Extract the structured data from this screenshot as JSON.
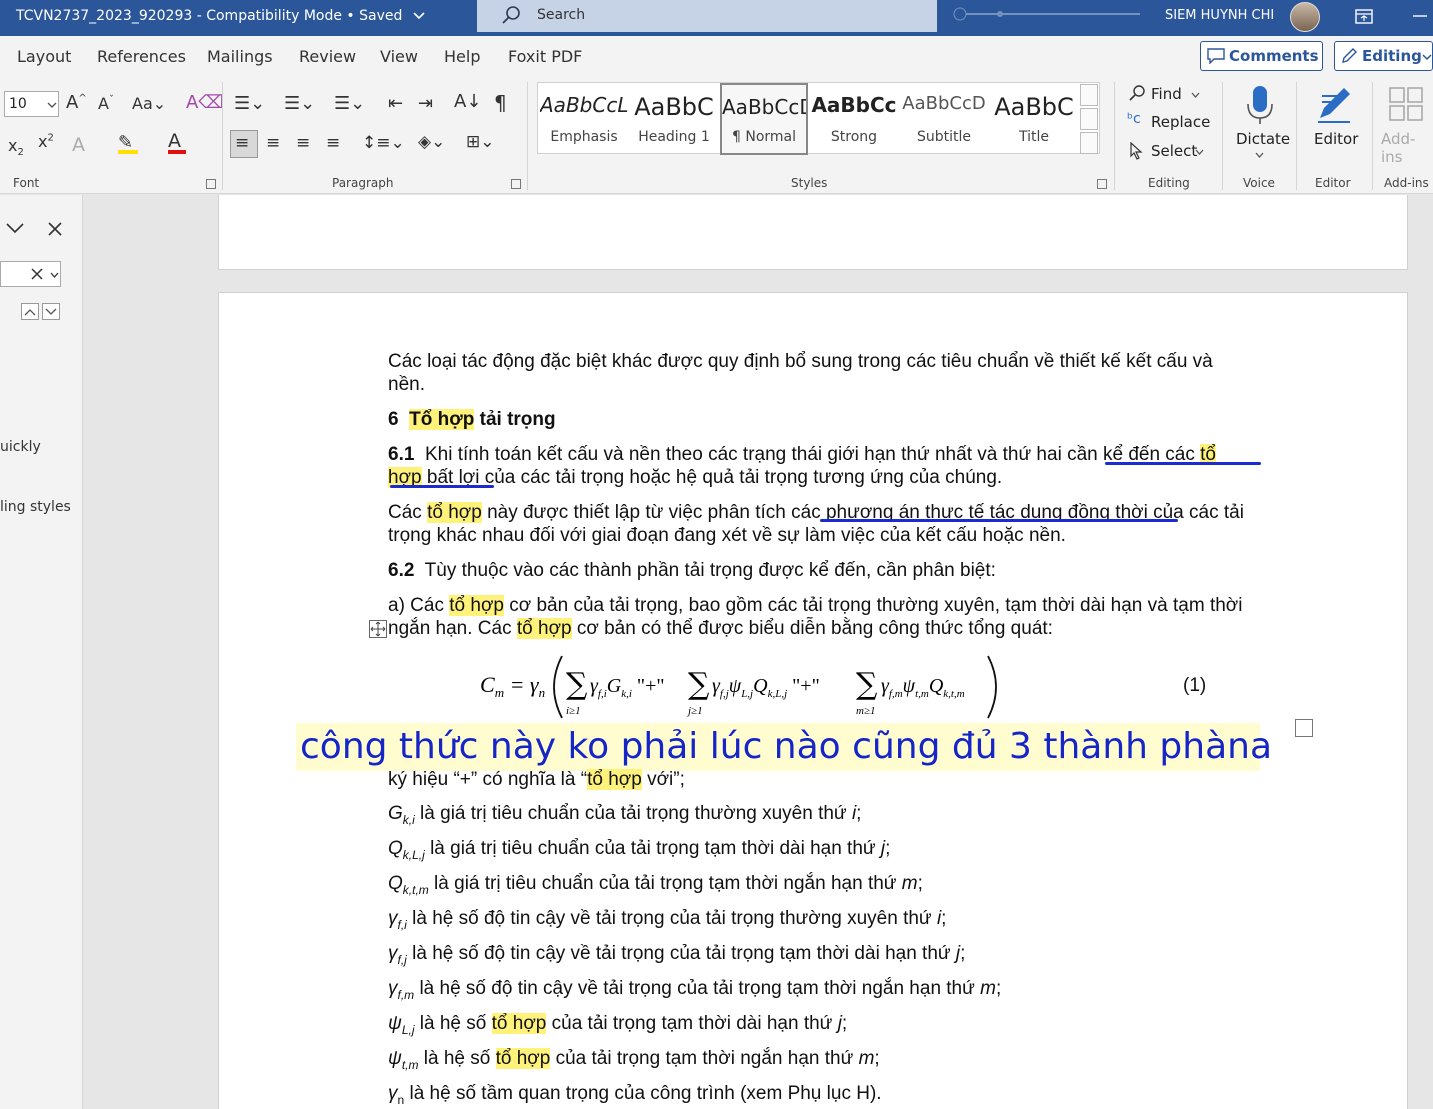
{
  "titlebar": {
    "doc_title": "TCVN2737_2023_920293 - Compatibility Mode • Saved",
    "search_label": "Search",
    "user_name": "SIEM HUYNH CHI"
  },
  "tabs": [
    "Layout",
    "References",
    "Mailings",
    "Review",
    "View",
    "Help",
    "Foxit PDF"
  ],
  "actions": {
    "comments": "Comments",
    "editing": "Editing"
  },
  "ribbon": {
    "font": {
      "size": "10",
      "label": "Font"
    },
    "paragraph_label": "Paragraph",
    "styles": {
      "label": "Styles",
      "items": [
        {
          "preview": "AaBbCcL",
          "name": "Emphasis"
        },
        {
          "preview": "AaBbC",
          "name": "Heading 1"
        },
        {
          "preview": "AaBbCcD",
          "name": "¶ Normal"
        },
        {
          "preview": "AaBbCc",
          "name": "Strong"
        },
        {
          "preview": "AaBbCcD",
          "name": "Subtitle"
        },
        {
          "preview": "AaBbC",
          "name": "Title"
        }
      ]
    },
    "editing": {
      "find": "Find",
      "replace": "Replace",
      "select": "Select",
      "label": "Editing"
    },
    "voice": {
      "dictate": "Dictate",
      "label": "Voice"
    },
    "editor": {
      "button": "Editor",
      "label": "Editor"
    },
    "addins": {
      "button": "Add-ins",
      "label": "Add-ins"
    }
  },
  "navpane": {
    "text1": "uickly",
    "text2": "ling styles"
  },
  "document": {
    "p1a": "Các loại tác động đặc biệt khác được quy định bổ sung trong các tiêu chuẩn về thiết kế kết cấu và",
    "p1b": "nền.",
    "h_num": "6",
    "h_hl": "Tổ hợp",
    "h_rest": " tải trọng",
    "p61_num": "6.1",
    "p61a_1": "Khi tính toán kết cấu và nền theo các trạng thái giới hạn thứ nhất và thứ hai cần kể đến các ",
    "p61a_hl": "tổ",
    "p61b_hl": "hợp",
    "p61b_rest": " bất lợi của các tải trọng hoặc hệ quả tải trọng tương ứng của chúng.",
    "p2a_1": "Các ",
    "p2a_hl": "tổ hợp",
    "p2a_rest": " này được thiết lập từ việc phân tích các phương án thực tế tác dụng đồng thời của các tải",
    "p2b": "trọng khác nhau đối với giai đoạn đang xét về sự làm việc của kết cấu hoặc nền.",
    "p62_num": "6.2",
    "p62_rest": "Tùy thuộc vào các thành phần tải trọng được kể đến, cần phân biệt:",
    "pa_1": "a) Các ",
    "pa_hl": "tổ hợp",
    "pa_rest": " cơ bản của tải trọng, bao gồm các tải trọng thường xuyên, tạm thời dài hạn và tạm thời",
    "pb_1": "ngắn hạn. Các ",
    "pb_hl": "tổ hợp",
    "pb_rest": " cơ bản có thể được biểu diễn bằng công thức tổng quát:",
    "eq_number": "(1)",
    "annotation": "công thức này ko phải lúc nào cũng đủ 3 thành phàna",
    "sym_1": "ký hiệu “+” có nghĩa là “",
    "sym_hl": "tổ hợp",
    "sym_2": " với”;",
    "d1_s": "G",
    "d1_sub": "k,i",
    "d1_t": " là giá trị tiêu chuẩn của tải trọng thường xuyên thứ ",
    "d1_i": "i",
    "d1_e": ";",
    "d2_s": "Q",
    "d2_sub": "k,L,j",
    "d2_t": " là giá trị tiêu chuẩn của tải trọng tạm thời dài hạn thứ ",
    "d2_i": "j",
    "d2_e": ";",
    "d3_s": "Q",
    "d3_sub": "k,t,m",
    "d3_t": " là giá trị tiêu chuẩn của tải trọng tạm thời ngắn hạn thứ ",
    "d3_i": "m",
    "d3_e": ";",
    "d4_s": "γ",
    "d4_sub": "f,i",
    "d4_t": " là hệ số độ tin cậy về tải trọng của tải trọng thường xuyên thứ ",
    "d4_i": "i",
    "d4_e": ";",
    "d5_s": "γ",
    "d5_sub": "f,j",
    "d5_t": " là hệ số độ tin cậy về tải trọng của tải trọng tạm thời dài hạn thứ ",
    "d5_i": "j",
    "d5_e": ";",
    "d6_s": "γ",
    "d6_sub": "f,m",
    "d6_t": " là hệ số độ tin cậy về tải trọng của tải trọng tạm thời ngắn hạn thứ ",
    "d6_i": "m",
    "d6_e": ";",
    "d7_s": "ψ",
    "d7_sub": "L,j",
    "d7_t1": " là hệ số ",
    "d7_hl": "tổ hợp",
    "d7_t2": " của tải trọng tạm thời dài hạn thứ ",
    "d7_i": "j",
    "d7_e": ";",
    "d8_s": "ψ",
    "d8_sub": "t,m",
    "d8_t1": " là hệ số ",
    "d8_hl": "tổ hợp",
    "d8_t2": " của tải trọng tạm thời ngắn hạn thứ ",
    "d8_i": "m",
    "d8_e": ";",
    "d9_s": "γ",
    "d9_sub": "n",
    "d9_t": " là hệ số tầm quan trọng của công trình (xem Phụ lục H)."
  }
}
